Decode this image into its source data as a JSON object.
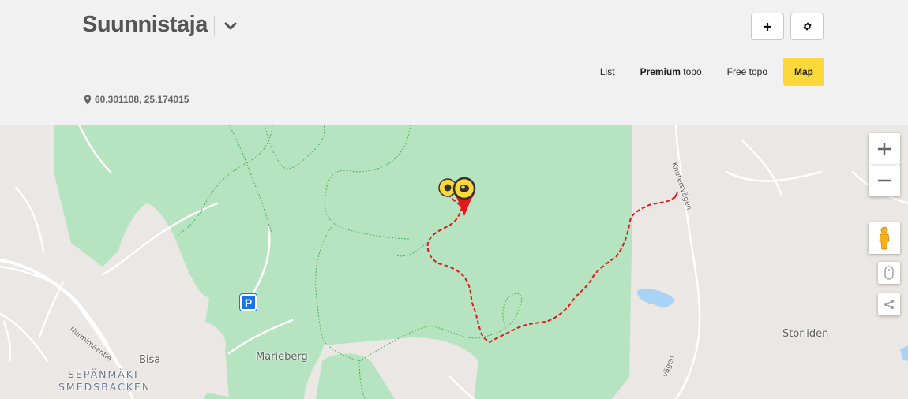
{
  "header": {
    "title": "Suunnistaja",
    "coordinates": "60.301108, 25.174015",
    "tabs": [
      {
        "label": "List",
        "bold": "",
        "rest": "List"
      },
      {
        "label": "Premium topo",
        "bold": "Premium",
        "rest": " topo"
      },
      {
        "label": "Free topo",
        "bold": "",
        "rest": "Free topo"
      },
      {
        "label": "Map",
        "bold": "Map",
        "rest": ""
      }
    ],
    "active_tab": "Map",
    "accent_color": "#fcd83a"
  },
  "map": {
    "places": {
      "marieberg": "Marieberg",
      "bisa": "Bisa",
      "sepanmaki": "SEPÄNMÄKI",
      "smedsbacken": "SMEDSBACKEN",
      "storliden": "Storliden"
    },
    "roads": {
      "nurmimaentie": "Nurmimäentie",
      "knutersvagen": "Knutersvägen",
      "vagen": "vägen"
    },
    "parking_label": "P",
    "forest_color": "#b7e4c0",
    "route_color": "#e0191e",
    "icons": [
      "chevron-down-icon",
      "plus-icon",
      "gear-icon",
      "map-pin-icon",
      "zoom-in-icon",
      "zoom-out-icon",
      "pegman-icon",
      "mouse-icon",
      "share-icon"
    ]
  }
}
